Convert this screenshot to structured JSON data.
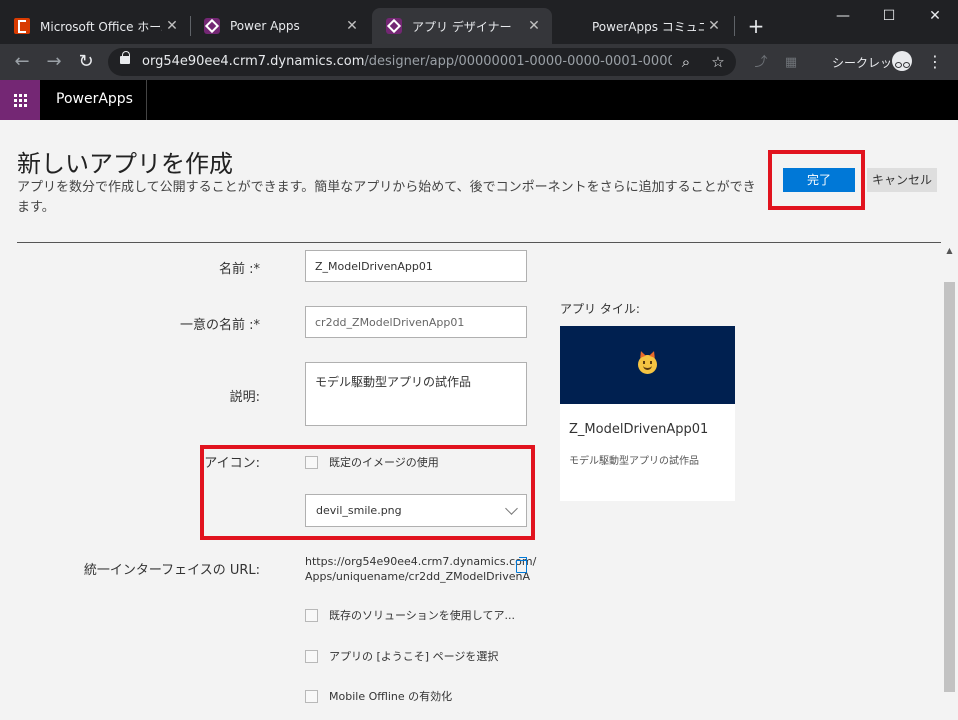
{
  "browser": {
    "tabs": [
      {
        "title": "Microsoft Office ホーム",
        "favicon": "office-icon",
        "active": false
      },
      {
        "title": "Power Apps",
        "favicon": "powerapps-icon",
        "active": false
      },
      {
        "title": "アプリ デザイナー",
        "favicon": "powerapps-icon",
        "active": true
      },
      {
        "title": "PowerApps コミュニティ",
        "favicon": "microsoft-icon",
        "active": false
      }
    ],
    "url_host": "org54e90ee4.crm7.dynamics.com",
    "url_path": "/designer/app/00000001-0000-0000-0001-00000...",
    "incognito_label": "シークレット"
  },
  "app": {
    "name": "PowerApps",
    "brand_color": "#742774"
  },
  "page": {
    "title": "新しいアプリを作成",
    "description": "アプリを数分で作成して公開することができます。簡単なアプリから始めて、後でコンポーネントをさらに追加することができます。",
    "done_label": "完了",
    "cancel_label": "キャンセル",
    "accent_color": "#0078d7",
    "highlight_color": "#e1131e"
  },
  "form": {
    "name_label": "名前 :*",
    "name_value": "Z_ModelDrivenApp01",
    "unique_name_label": "一意の名前 :*",
    "unique_name_value": "cr2dd_ZModelDrivenApp01",
    "description_label": "説明:",
    "description_value": "モデル駆動型アプリの試作品",
    "icon_label": "アイコン:",
    "default_image_label": "既定のイメージの使用",
    "default_image_checked": false,
    "icon_select_value": "devil_smile.png",
    "url_label": "統一インターフェイスの URL:",
    "url_line1": "https://org54e90ee4.crm7.dynamics.com/",
    "url_line2": "Apps/uniquename/cr2dd_ZModelDrivenA",
    "use_solution_label": "既存のソリューションを使用してア...",
    "welcome_page_label": "アプリの [ようこそ] ページを選択",
    "mobile_offline_label": "Mobile Offline の有効化"
  },
  "tile": {
    "label": "アプリ タイル:",
    "name": "Z_ModelDrivenApp01",
    "description": "モデル駆動型アプリの試作品",
    "banner_color": "#002050"
  }
}
